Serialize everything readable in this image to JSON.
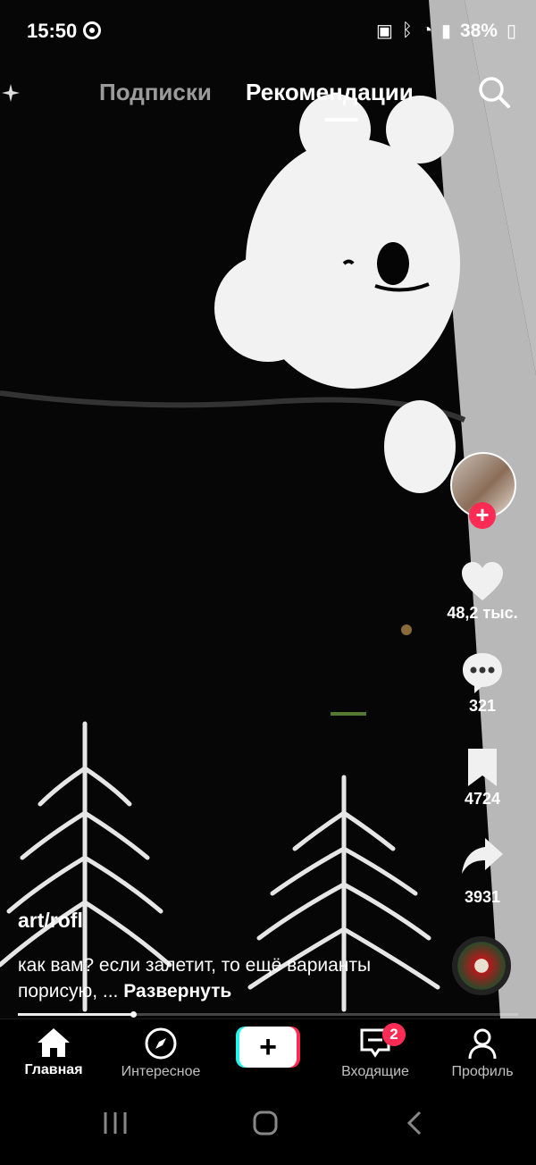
{
  "status_bar": {
    "time": "15:50",
    "battery": "38%"
  },
  "top_nav": {
    "tab_following": "Подписки",
    "tab_for_you": "Рекомендации"
  },
  "video": {
    "author": "art/rofl",
    "description": "как вам? если залетит, то ещё варианты порисую, ...",
    "expand_label": "Развернуть",
    "progress": 0.23
  },
  "actions": {
    "likes": "48,2 тыс.",
    "comments": "321",
    "saves": "4724",
    "shares": "3931",
    "follow_symbol": "+"
  },
  "bottom_nav": {
    "home": "Главная",
    "discover": "Интересное",
    "create_symbol": "+",
    "inbox": "Входящие",
    "inbox_badge": "2",
    "profile": "Профиль"
  },
  "colors": {
    "accent": "#fe2c55",
    "cyan": "#25f4ee"
  }
}
